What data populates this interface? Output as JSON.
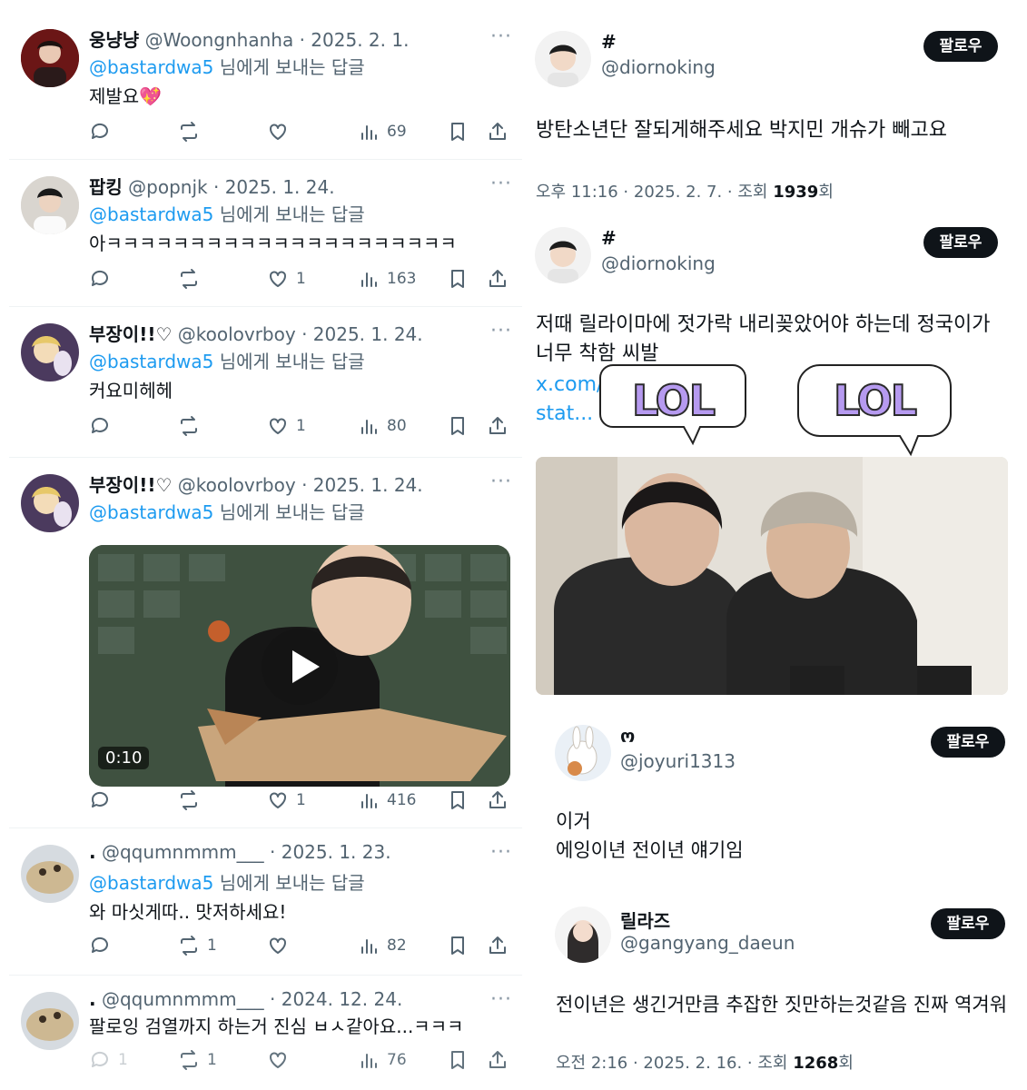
{
  "replies": [
    {
      "name": "웅냥냥",
      "handle": "@Woongnhanha",
      "date": "· 2025. 2. 1.",
      "replying_mention": "@bastardwa5",
      "replying_suffix": " 님에게 보내는 답글",
      "text": "제발요💖",
      "retweets": "",
      "likes": "",
      "views": "69"
    },
    {
      "name": "팝킹",
      "handle": "@popnjk",
      "date": "· 2025. 1. 24.",
      "replying_mention": "@bastardwa5",
      "replying_suffix": " 님에게 보내는 답글",
      "text": "아ㅋㅋㅋㅋㅋㅋㅋㅋㅋㅋㅋㅋㅋㅋㅋㅋㅋㅋㅋㅋㅋ",
      "retweets": "",
      "likes": "1",
      "views": "163"
    },
    {
      "name": "부장이!!♡",
      "handle": "@koolovrboy",
      "date": "· 2025. 1. 24.",
      "replying_mention": "@bastardwa5",
      "replying_suffix": " 님에게 보내는 답글",
      "text": "커요미헤헤",
      "retweets": "",
      "likes": "1",
      "views": "80"
    },
    {
      "name": "부장이!!♡",
      "handle": "@koolovrboy",
      "date": "· 2025. 1. 24.",
      "replying_mention": "@bastardwa5",
      "replying_suffix": " 님에게 보내는 답글",
      "text": "",
      "video_duration": "0:10",
      "retweets": "",
      "likes": "1",
      "views": "416"
    },
    {
      "name": ".",
      "handle": "@qqumnmmm___",
      "date": "· 2025. 1. 23.",
      "replying_mention": "@bastardwa5",
      "replying_suffix": " 님에게 보내는 답글",
      "text": "와 마싯게따.. 맛저하세요!",
      "retweets": "1",
      "likes": "",
      "views": "82"
    },
    {
      "name": ".",
      "handle": "@qqumnmmm___",
      "date": "· 2024. 12. 24.",
      "text": "팔로잉 검열까지 하는거 진심 ㅂㅅ같아요...ㅋㅋㅋ",
      "replies_count": "1",
      "retweets": "1",
      "likes": "",
      "views": "76"
    }
  ],
  "more_label": "···",
  "right": {
    "tweet1": {
      "name": "#",
      "handle": "@diornoking",
      "follow": "팔로우",
      "text": "방탄소년단 잘되게해주세요 박지민 개슈가 빼고요",
      "meta_prefix": "오후 11:16 · 2025. 2. 7. · 조회 ",
      "views": "1939",
      "meta_suffix": "회"
    },
    "tweet2": {
      "name": "#",
      "handle": "@diornoking",
      "follow": "팔로우",
      "line1": "저때 릴라이마에 젓가락 내리꽂았어야 하는데 정국이가",
      "line2": "너무 착함 씨발",
      "link1": "x.com/",
      "link2": "stat...",
      "sticker": "LOL"
    },
    "comment1": {
      "name": "ო",
      "handle": "@joyuri1313",
      "follow": "팔로우",
      "line1": "이거",
      "line2": "에잉이년 전이년 얘기임"
    },
    "comment2": {
      "name": "릴라즈",
      "handle": "@gangyang_daeun",
      "follow": "팔로우",
      "text": "전이년은 생긴거만큼 추잡한 짓만하는것같음 진짜 역겨워",
      "meta_prefix": "오전 2:16 · 2025. 2. 16. · 조회 ",
      "views": "1268",
      "meta_suffix": "회"
    }
  }
}
